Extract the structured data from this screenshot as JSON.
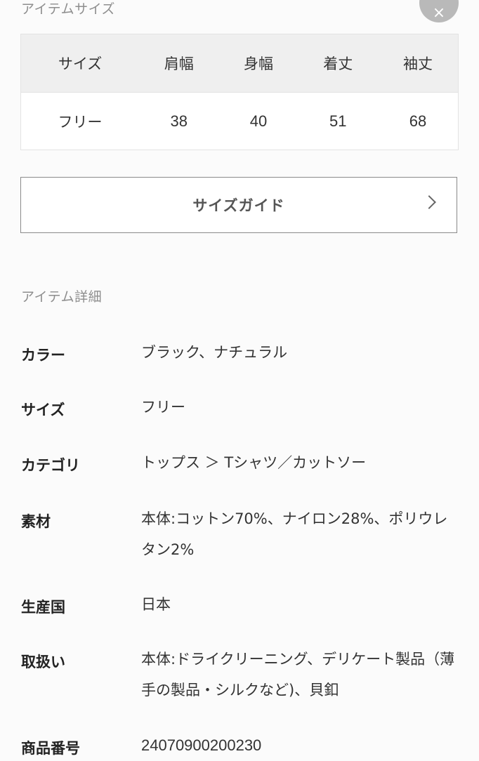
{
  "item_size": {
    "title": "アイテムサイズ",
    "close_glyph": "×",
    "columns": [
      "サイズ",
      "肩幅",
      "身幅",
      "着丈",
      "袖丈"
    ],
    "rows": [
      [
        "フリー",
        "38",
        "40",
        "51",
        "68"
      ]
    ]
  },
  "size_guide": {
    "label": "サイズガイド",
    "chevron_icon": "chevron-right-icon"
  },
  "item_detail": {
    "title": "アイテム詳細",
    "rows": [
      {
        "label": "カラー",
        "value": "ブラック、ナチュラル"
      },
      {
        "label": "サイズ",
        "value": "フリー"
      },
      {
        "label": "カテゴリ",
        "value": "トップス ＞ Tシャツ／カットソー"
      },
      {
        "label": "素材",
        "value": "本体:コットン70%、ナイロン28%、ポリウレタン2%"
      },
      {
        "label": "生産国",
        "value": "日本"
      },
      {
        "label": "取扱い",
        "value": "本体:ドライクリーニング、デリケート製品（薄手の製品・シルクなど)、貝釦"
      },
      {
        "label": "商品番号",
        "value": "24070900200230"
      }
    ]
  }
}
